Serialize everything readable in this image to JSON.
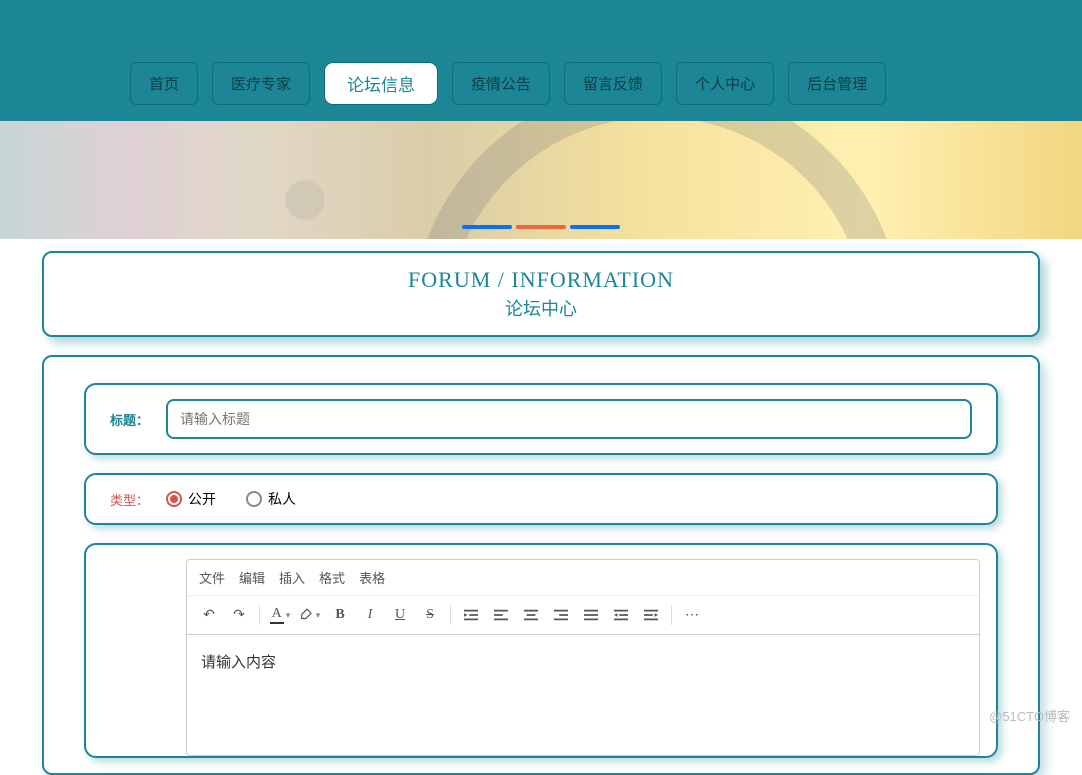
{
  "nav": {
    "items": [
      {
        "label": "首页",
        "key": "home"
      },
      {
        "label": "医疗专家",
        "key": "doctor"
      },
      {
        "label": "论坛信息",
        "key": "forum"
      },
      {
        "label": "疫情公告",
        "key": "notice"
      },
      {
        "label": "留言反馈",
        "key": "feedback"
      },
      {
        "label": "个人中心",
        "key": "user"
      },
      {
        "label": "后台管理",
        "key": "admin"
      }
    ],
    "active_index": 2
  },
  "banner": {
    "dot_colors": [
      "#0d6ff0",
      "#e96a3a",
      "#0d6ff0"
    ]
  },
  "header": {
    "en": "FORUM / INFORMATION",
    "cn": "论坛中心"
  },
  "form": {
    "title_label": "标题：",
    "title_placeholder": "请输入标题",
    "title_value": "",
    "type_label": "类型：",
    "options": [
      {
        "label": "公开",
        "value": "public",
        "selected": true
      },
      {
        "label": "私人",
        "value": "private",
        "selected": false
      }
    ]
  },
  "editor": {
    "menus": [
      "文件",
      "编辑",
      "插入",
      "格式",
      "表格"
    ],
    "content_placeholder": "请输入内容"
  },
  "watermark": "@51CTO博客"
}
